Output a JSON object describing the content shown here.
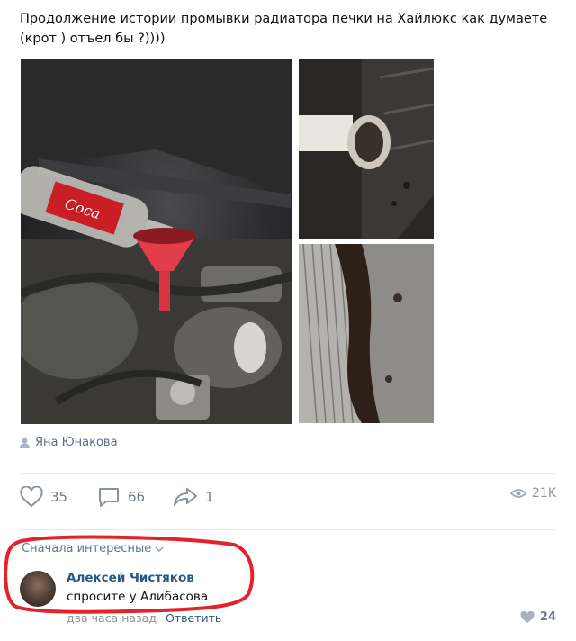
{
  "post": {
    "text": "Продолжение истории промывки радиатора печки на Хайлюкс как думаете (крот ) отъел бы ?))))",
    "photos": [
      {
        "id": "main",
        "icon": "car-engine-photo",
        "caption": "Coca-Cola bottle pouring into red funnel under hood"
      },
      {
        "id": "side1",
        "icon": "hose-dirt-photo",
        "caption": "hose with dirty residue"
      },
      {
        "id": "side2",
        "icon": "radiator-photo",
        "caption": "radiator with dark sludge"
      }
    ],
    "author": "Яна Юнакова"
  },
  "actions": {
    "likes": "35",
    "comments": "66",
    "shares": "1",
    "views": "21K"
  },
  "comments_section": {
    "sort_label": "Сначала интересные",
    "comment": {
      "author": "Алексей Чистяков",
      "text": "спросите у Алибасова",
      "time": "два часа назад",
      "reply_label": "Ответить",
      "likes": "24"
    }
  },
  "colors": {
    "link": "#2a5885",
    "muted": "#8a949f",
    "annotation_red": "#e0242a"
  }
}
